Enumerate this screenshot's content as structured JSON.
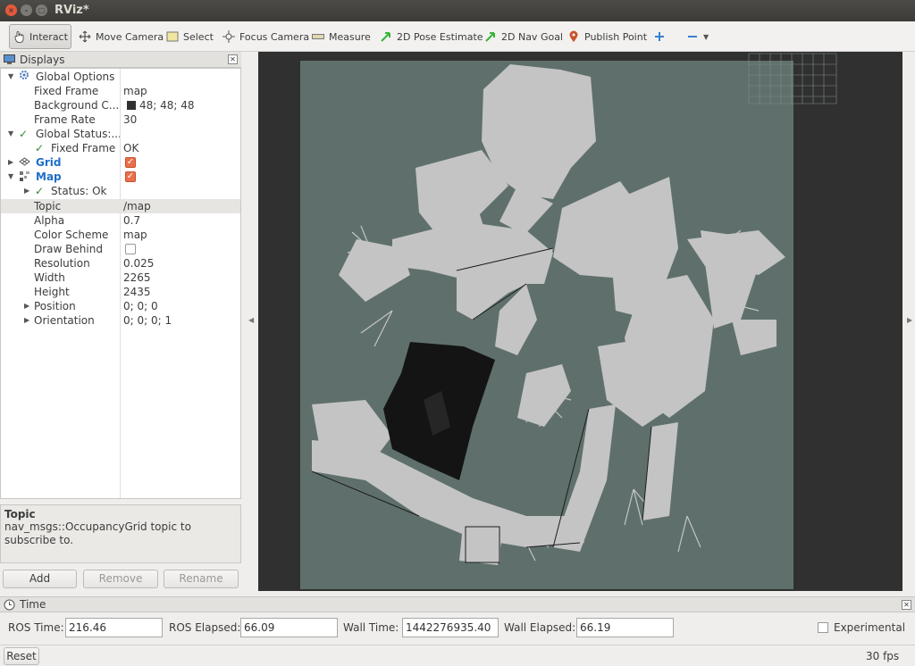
{
  "window": {
    "title": "RViz*"
  },
  "toolbar": {
    "tools": [
      {
        "label": "Interact",
        "icon": "hand-pointer-icon",
        "active": true
      },
      {
        "label": "Move Camera",
        "icon": "move-camera-icon"
      },
      {
        "label": "Select",
        "icon": "select-icon"
      },
      {
        "label": "Focus Camera",
        "icon": "focus-camera-icon"
      },
      {
        "label": "Measure",
        "icon": "measure-icon"
      },
      {
        "label": "2D Pose Estimate",
        "icon": "pose-arrow-icon"
      },
      {
        "label": "2D Nav Goal",
        "icon": "nav-goal-arrow-icon"
      },
      {
        "label": "Publish Point",
        "icon": "map-pin-icon"
      }
    ]
  },
  "displays": {
    "title": "Displays",
    "global_options": {
      "label": "Global Options",
      "fixed_frame_label": "Fixed Frame",
      "fixed_frame": "map",
      "background_label": "Background C...",
      "background": "48; 48; 48",
      "frame_rate_label": "Frame Rate",
      "frame_rate": "30"
    },
    "global_status": {
      "label": "Global Status:...",
      "fixed_frame_label": "Fixed Frame",
      "fixed_frame_value": "OK"
    },
    "grid": {
      "label": "Grid",
      "enabled": true
    },
    "map": {
      "label": "Map",
      "enabled": true,
      "status_label": "Status: Ok",
      "props": [
        {
          "key": "Topic",
          "value": "/map"
        },
        {
          "key": "Alpha",
          "value": "0.7"
        },
        {
          "key": "Color Scheme",
          "value": "map"
        },
        {
          "key": "Draw Behind",
          "value": ""
        },
        {
          "key": "Resolution",
          "value": "0.025"
        },
        {
          "key": "Width",
          "value": "2265"
        },
        {
          "key": "Height",
          "value": "2435"
        },
        {
          "key": "Position",
          "value": "0; 0; 0"
        },
        {
          "key": "Orientation",
          "value": "0; 0; 0; 1"
        }
      ]
    },
    "help": {
      "title": "Topic",
      "text": "nav_msgs::OccupancyGrid topic to subscribe to."
    },
    "buttons": {
      "add": "Add",
      "remove": "Remove",
      "rename": "Rename"
    }
  },
  "time_panel": {
    "title": "Time",
    "ros_time_label": "ROS Time:",
    "ros_time": "216.46",
    "ros_elapsed_label": "ROS Elapsed:",
    "ros_elapsed": "66.09",
    "wall_time_label": "Wall Time:",
    "wall_time": "1442276935.40",
    "wall_elapsed_label": "Wall Elapsed:",
    "wall_elapsed": "66.19",
    "experimental_label": "Experimental"
  },
  "status_bar": {
    "reset": "Reset",
    "fps": "30 fps"
  },
  "colors": {
    "background": "#303030",
    "map_unknown": "#5f706c",
    "map_free": "#c4c4c4",
    "map_occupied": "#141414"
  }
}
